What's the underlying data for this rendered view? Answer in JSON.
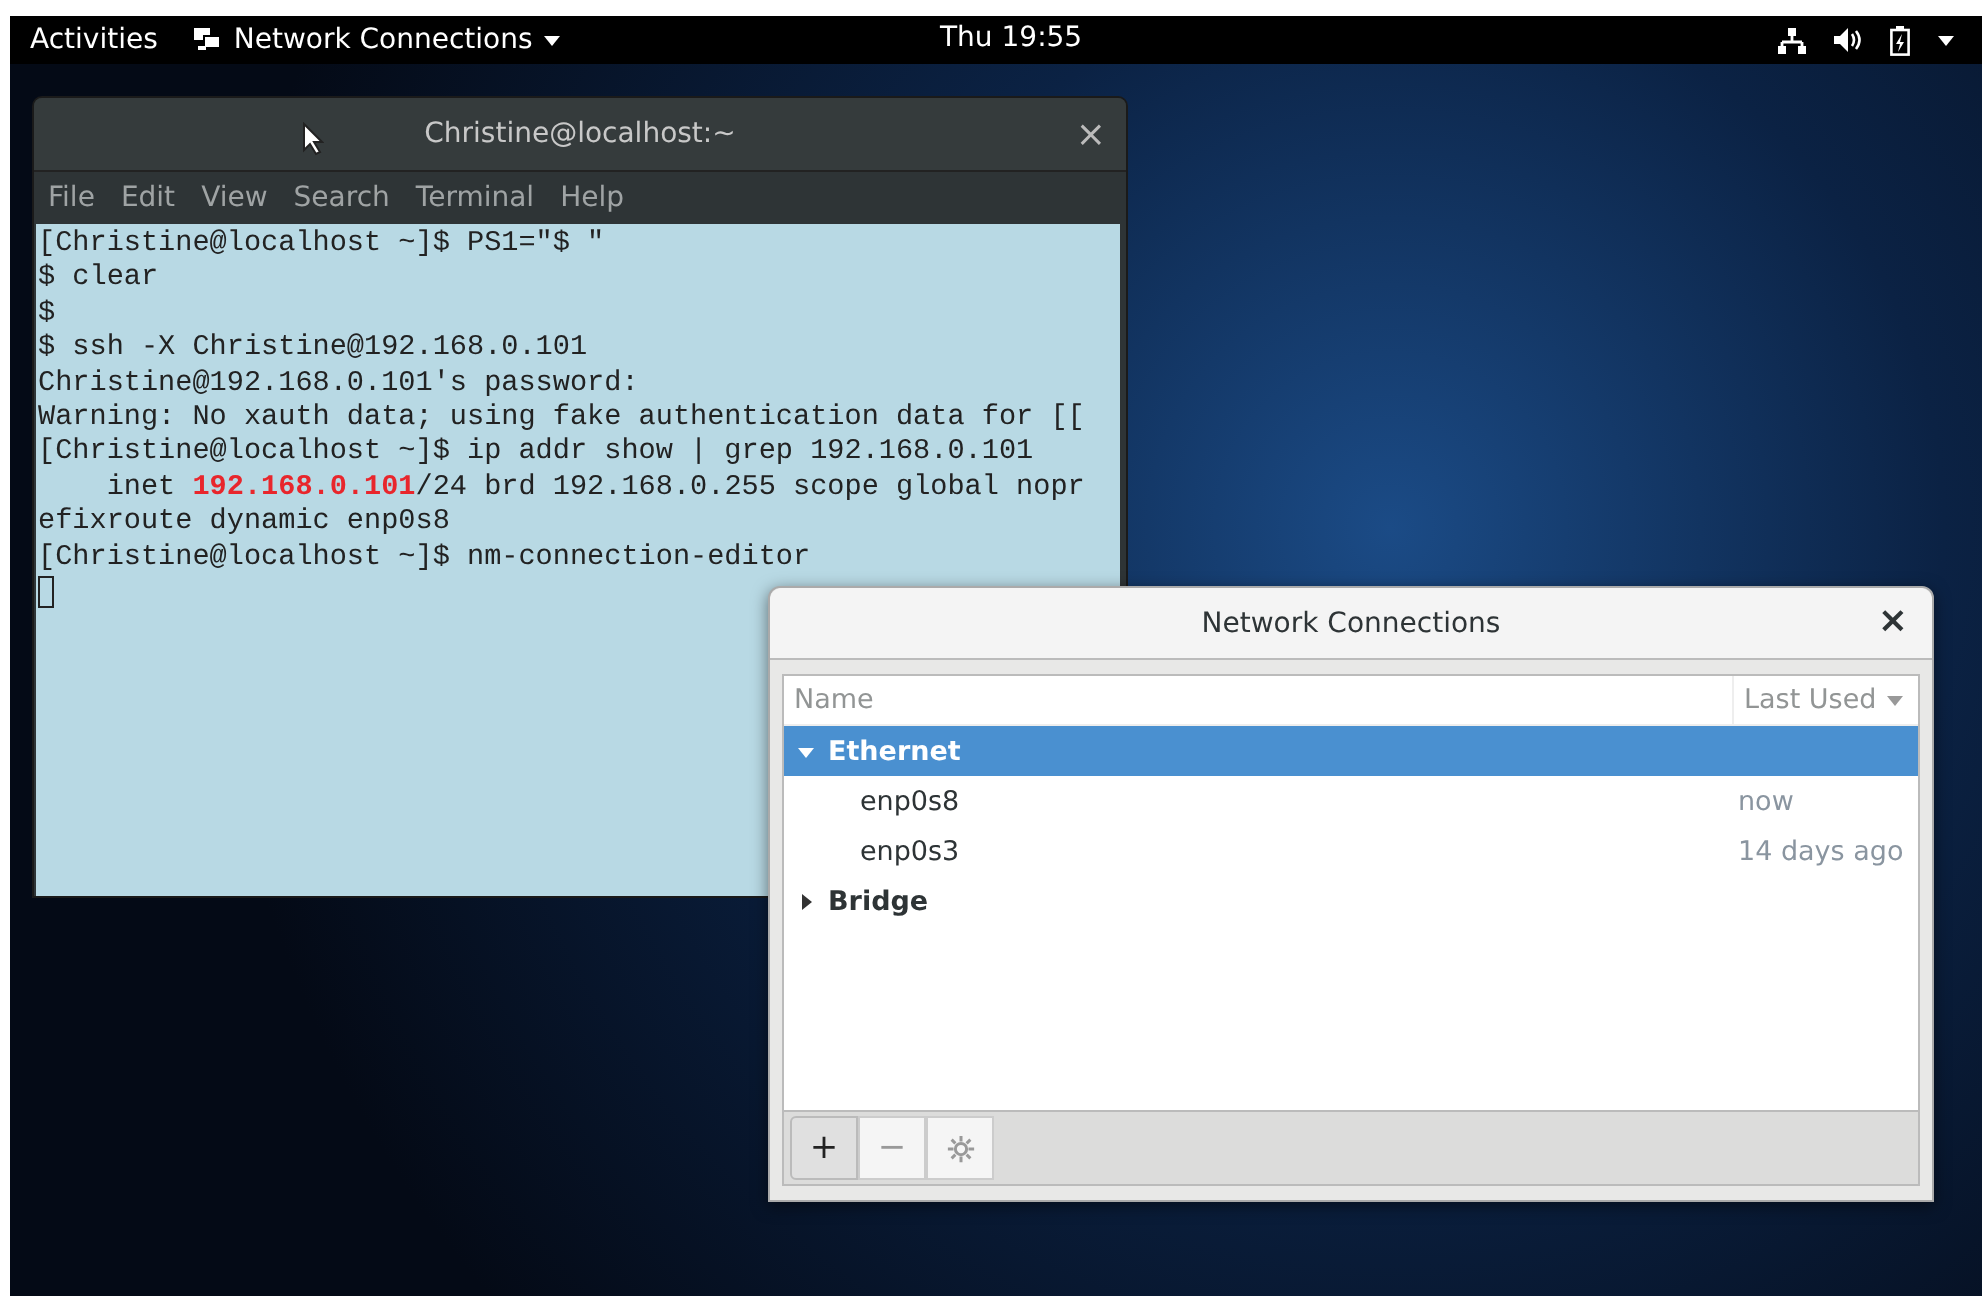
{
  "top_bar": {
    "activities": "Activities",
    "app_menu": "Network Connections",
    "clock": "Thu 19:55"
  },
  "terminal": {
    "title": "Christine@localhost:~",
    "close": "×",
    "menu": [
      "File",
      "Edit",
      "View",
      "Search",
      "Terminal",
      "Help"
    ],
    "lines": [
      [
        {
          "text": "[Christine@localhost ~]$ PS1=\"$ \"",
          "highlight": false
        }
      ],
      [
        {
          "text": "$ clear",
          "highlight": false
        }
      ],
      [
        {
          "text": "$",
          "highlight": false
        }
      ],
      [
        {
          "text": "$ ssh -X Christine@192.168.0.101",
          "highlight": false
        }
      ],
      [
        {
          "text": "Christine@192.168.0.101's password:",
          "highlight": false
        }
      ],
      [
        {
          "text": "Warning: No xauth data; using fake authentication data for [[",
          "highlight": false
        }
      ],
      [
        {
          "text": "[Christine@localhost ~]$ ip addr show | grep 192.168.0.101",
          "highlight": false
        }
      ],
      [
        {
          "text": "    inet ",
          "highlight": false
        },
        {
          "text": "192.168.0.101",
          "highlight": true
        },
        {
          "text": "/24 brd 192.168.0.255 scope global nopr",
          "highlight": false
        }
      ],
      [
        {
          "text": "efixroute dynamic enp0s8",
          "highlight": false
        }
      ],
      [
        {
          "text": "[Christine@localhost ~]$ nm-connection-editor",
          "highlight": false
        }
      ]
    ]
  },
  "dialog": {
    "title": "Network Connections",
    "close": "×",
    "columns": [
      {
        "label": "Name",
        "sort": false
      },
      {
        "label": "Last Used",
        "sort": true
      }
    ],
    "groups": [
      {
        "name": "Ethernet",
        "expanded": true,
        "selected": true,
        "children": [
          {
            "name": "enp0s8",
            "last_used": "now"
          },
          {
            "name": "enp0s3",
            "last_used": "14 days ago"
          }
        ]
      },
      {
        "name": "Bridge",
        "expanded": false,
        "selected": false
      }
    ],
    "buttons": [
      {
        "label": "+",
        "kind": "add"
      },
      {
        "label": "−",
        "kind": "remove"
      },
      {
        "kind": "settings"
      }
    ]
  }
}
